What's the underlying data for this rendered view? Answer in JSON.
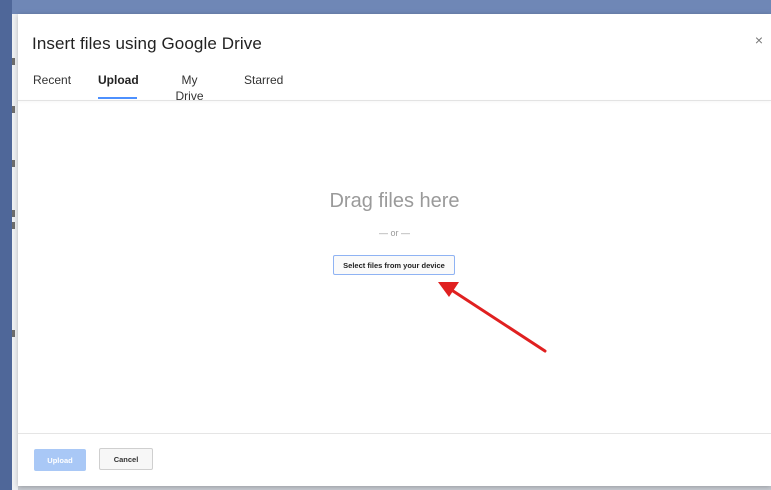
{
  "dialog": {
    "title": "Insert files using Google Drive",
    "close_glyph": "×"
  },
  "tabs": [
    {
      "label": "Recent",
      "active": false
    },
    {
      "label": "Upload",
      "active": true
    },
    {
      "label": "My Drive",
      "active": false
    },
    {
      "label": "Starred",
      "active": false
    }
  ],
  "dropzone": {
    "title": "Drag files here",
    "separator": "— or —",
    "select_label": "Select files from your device"
  },
  "footer": {
    "upload_label": "Upload",
    "cancel_label": "Cancel"
  },
  "colors": {
    "accent": "#4d90fe",
    "annotation_arrow": "#e02020",
    "upload_disabled": "#a9c8f6"
  }
}
